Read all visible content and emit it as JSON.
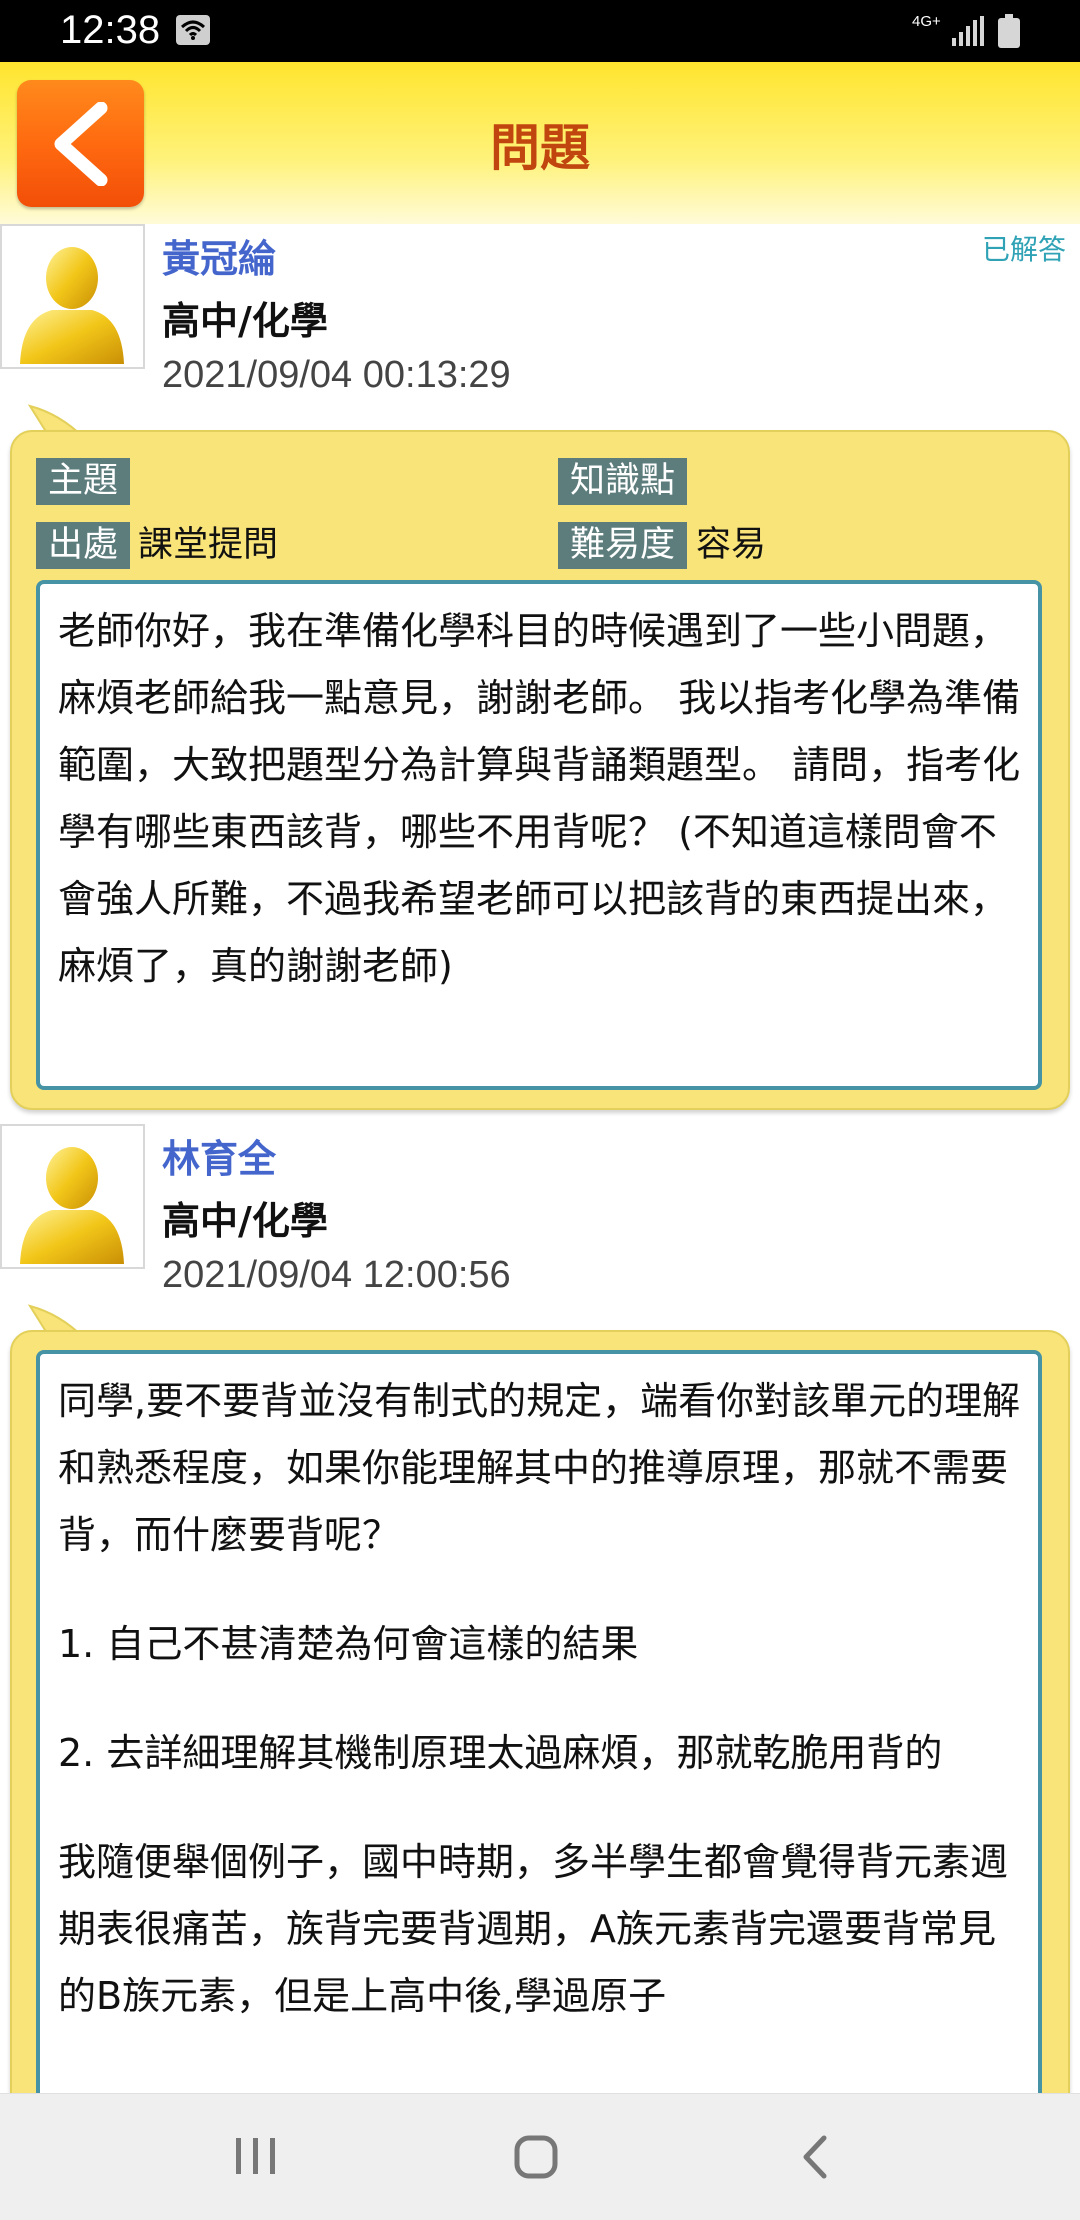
{
  "status_bar": {
    "time": "12:38",
    "network_label": "4G+",
    "icons": [
      "wifi-icon",
      "signal-icon",
      "battery-icon"
    ]
  },
  "header": {
    "title": "問題",
    "back_icon": "chevron-left-icon",
    "colors": {
      "bar": "#ffe52e",
      "back_button": "#ff6a10",
      "title": "#c0450f"
    }
  },
  "question": {
    "author": "黃冠綸",
    "subject": "高中/化學",
    "timestamp": "2021/09/04 00:13:29",
    "status": "已解答",
    "tags": {
      "topic_label": "主題",
      "topic_value": "",
      "knowledge_label": "知識點",
      "knowledge_value": "",
      "source_label": "出處",
      "source_value": "課堂提問",
      "difficulty_label": "難易度",
      "difficulty_value": "容易"
    },
    "body": "老師你好，我在準備化學科目的時候遇到了一些小問題，麻煩老師給我一點意見，謝謝老師。 我以指考化學為準備範圍，大致把題型分為計算與背誦類題型。 請問，指考化學有哪些東西該背，哪些不用背呢？ (不知道這樣問會不會強人所難，不過我希望老師可以把該背的東西提出來，麻煩了，真的謝謝老師)"
  },
  "answer": {
    "author": "林育全",
    "subject": "高中/化學",
    "timestamp": "2021/09/04 12:00:56",
    "paragraphs": [
      "同學,要不要背並沒有制式的規定，端看你對該單元的理解和熟悉程度，如果你能理解其中的推導原理，那就不需要背，而什麼要背呢？",
      "1. 自己不甚清楚為何會這樣的結果",
      "2. 去詳細理解其機制原理太過麻煩，那就乾脆用背的",
      "我隨便舉個例子，國中時期，多半學生都會覺得背元素週期表很痛苦，族背完要背週期，A族元素背完還要背常見的B族元素，但是上高中後,學過原子"
    ]
  },
  "nav_bar": {
    "icons": [
      "recent-apps-icon",
      "home-icon",
      "back-icon"
    ]
  }
}
